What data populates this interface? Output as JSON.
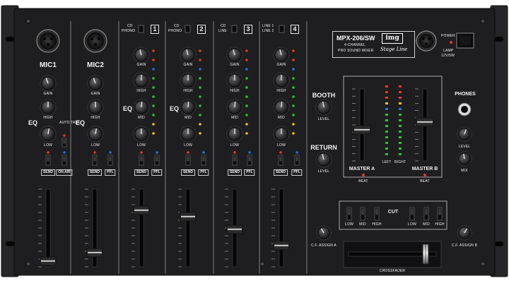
{
  "device": {
    "model": "MPX-206/SW",
    "subtitle_line1": "4-CHANNEL",
    "subtitle_line2": "PRO SOUND MIXER",
    "logo": "img",
    "brand": "Stage Line",
    "power_label": "POWER",
    "lamp_label": "LAMP",
    "lamp_spec": "12V/5W"
  },
  "channels": [
    {
      "label": "MIC1",
      "gain": "GAIN",
      "high": "HIGH",
      "low": "LOW",
      "send": "SEND",
      "button": "ON AIR",
      "auto_talk": "AUTO TALK",
      "eq": "EQ"
    },
    {
      "label": "MIC2",
      "gain": "GAIN",
      "high": "HIGH",
      "low": "LOW",
      "send": "SEND",
      "button": "PFL",
      "eq": "EQ"
    },
    {
      "number": "1",
      "sw_top": "CD",
      "sw_bottom": "PHONO",
      "gain": "GAIN",
      "high": "HIGH",
      "mid": "MID",
      "low": "LOW",
      "send": "SEND",
      "button": "PFL",
      "eq": "EQ"
    },
    {
      "number": "2",
      "sw_top": "CD",
      "sw_bottom": "PHONO",
      "gain": "GAIN",
      "high": "HIGH",
      "mid": "MID",
      "low": "LOW",
      "send": "SEND",
      "button": "PFL",
      "eq": "EQ"
    },
    {
      "number": "3",
      "sw_top": "CD",
      "sw_bottom": "LINE",
      "gain": "GAIN",
      "high": "HIGH",
      "mid": "MID",
      "low": "LOW",
      "send": "SEND",
      "button": "PFL"
    },
    {
      "number": "4",
      "sw_top": "LINE 1",
      "sw_bottom": "LINE 2",
      "gain": "GAIN",
      "high": "HIGH",
      "mid": "MID",
      "low": "LOW",
      "send": "SEND",
      "button": "PFL"
    }
  ],
  "sections": {
    "booth": "BOOTH",
    "booth_level": "LEVEL",
    "return": "RETURN",
    "return_level": "LEVEL",
    "master_a": "MASTER A",
    "master_b": "MASTER B",
    "beat_a": "BEAT",
    "beat_b": "BEAT",
    "left": "LEFT",
    "right": "RIGHT",
    "phones": "PHONES",
    "phones_level": "LEVEL",
    "phones_mix": "MIX",
    "cut": "CUT",
    "cut_low_a": "LOW",
    "cut_mid_a": "MID",
    "cut_high_a": "HIGH",
    "cut_low_b": "LOW",
    "cut_mid_b": "MID",
    "cut_high_b": "HIGH",
    "cf_assign_a": "C.F. ASSIGN A",
    "cf_assign_b": "C.F. ASSIGN B",
    "crossfader": "CROSSFADER"
  },
  "colors": {
    "panel": "#1e1e20",
    "knob": "#3a3a3c",
    "led_red": "#e23a2a",
    "led_blue": "#2a6fd8",
    "led_green": "#2fbf3a",
    "led_yellow": "#e8c21e"
  }
}
